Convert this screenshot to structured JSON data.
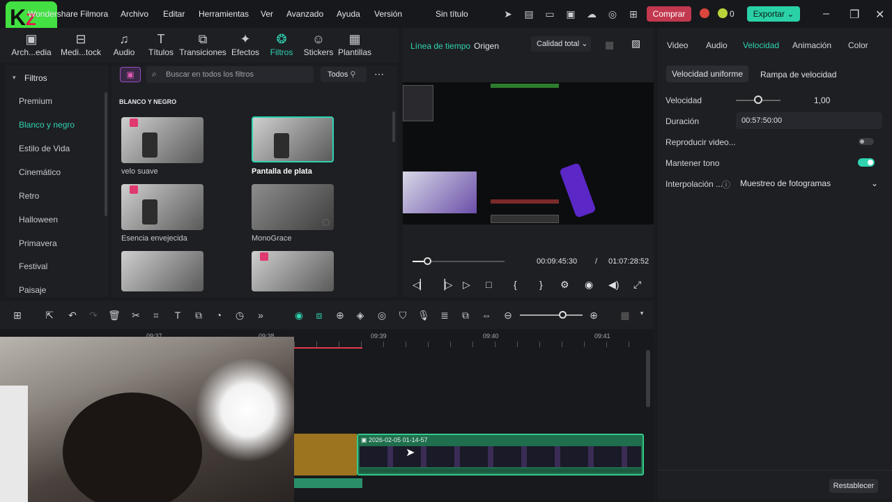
{
  "titlebar": {
    "app_name": "Wondershare Filmora",
    "menus": [
      "Archivo",
      "Editar",
      "Herramientas",
      "Ver",
      "Avanzado",
      "Ayuda",
      "Versión"
    ],
    "project_title": "Sin título",
    "buy_label": "Comprar",
    "credits": "0",
    "export_label": "Exportar"
  },
  "library": {
    "tabs": [
      "Arch...edia",
      "Medi...tock",
      "Audio",
      "Títulos",
      "Transiciones",
      "Efectos",
      "Filtros",
      "Stickers",
      "Plantillas"
    ],
    "active": "Filtros"
  },
  "filters": {
    "section": "Filtros",
    "nav": [
      "Premium",
      "Blanco y negro",
      "Estilo de Vida",
      "Cinemático",
      "Retro",
      "Halloween",
      "Primavera",
      "Festival",
      "Paisaje"
    ],
    "active_nav": "Blanco y negro",
    "search_placeholder": "Buscar en todos los filtros",
    "scope": "Todos",
    "category_title": "BLANCO Y NEGRO",
    "items": [
      "velo suave",
      "Pantalla de plata",
      "Esencia envejecida",
      "MonoGrace"
    ]
  },
  "preview": {
    "tab_timeline": "Línea de tiempo",
    "tab_source": "Origen",
    "quality": "Calidad total",
    "current_time": "00:09:45:30",
    "separator": "/",
    "total_time": "01:07:28:52"
  },
  "properties": {
    "tabs": [
      "Video",
      "Audio",
      "Velocidad",
      "Animación",
      "Color"
    ],
    "active_tab": "Velocidad",
    "subtabs": [
      "Velocidad uniforme",
      "Rampa de velocidad"
    ],
    "speed_label": "Velocidad",
    "speed_value": "1,00",
    "duration_label": "Duración",
    "duration_value": "00:57:50:00",
    "reverse_label": "Reproducir video...",
    "keep_pitch_label": "Mantener tono",
    "interp_label": "Interpolación ...",
    "interp_value": "Muestreo de fotogramas",
    "reset_label": "Restablecer"
  },
  "timeline": {
    "ruler": [
      "09:37",
      "09:38",
      "09:39",
      "09:40",
      "09:41"
    ],
    "clip_label": "2026-02-05 01-14-57"
  },
  "colors": {
    "accent": "#2fd3b0",
    "buy": "#c2384f",
    "export": "#2ad1a7"
  }
}
